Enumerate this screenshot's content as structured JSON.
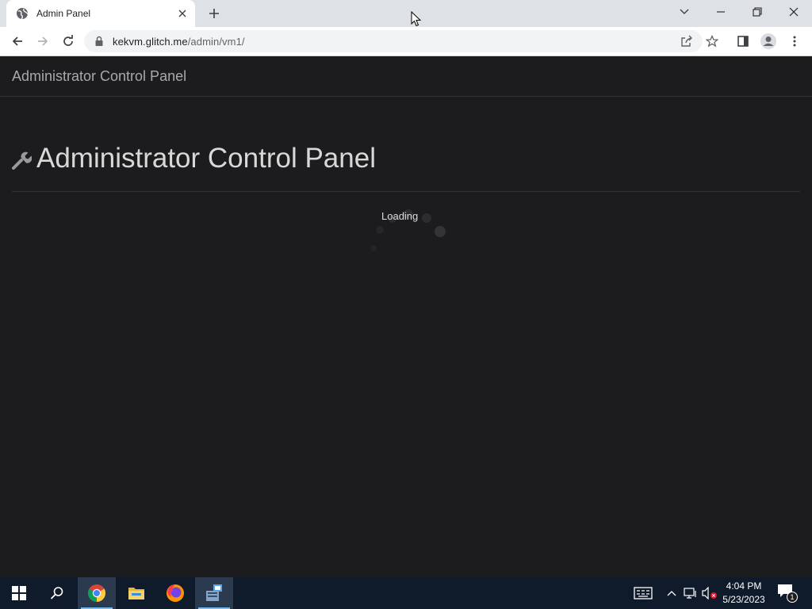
{
  "browser": {
    "tab_title": "Admin Panel",
    "url_host": "kekvm.glitch.me",
    "url_path": "/admin/vm1/"
  },
  "page": {
    "navbar_brand": "Administrator Control Panel",
    "heading": "Administrator Control Panel",
    "loading_text": "Loading"
  },
  "taskbar": {
    "time": "4:04 PM",
    "date": "5/23/2023",
    "notification_count": "1",
    "apps": [
      "start",
      "search",
      "chrome",
      "file-explorer",
      "firefox",
      "server-manager"
    ]
  },
  "colors": {
    "page_background": "#1c1c1e",
    "taskbar_background": "#0f1a2a",
    "tabstrip_background": "#dee1e6"
  }
}
